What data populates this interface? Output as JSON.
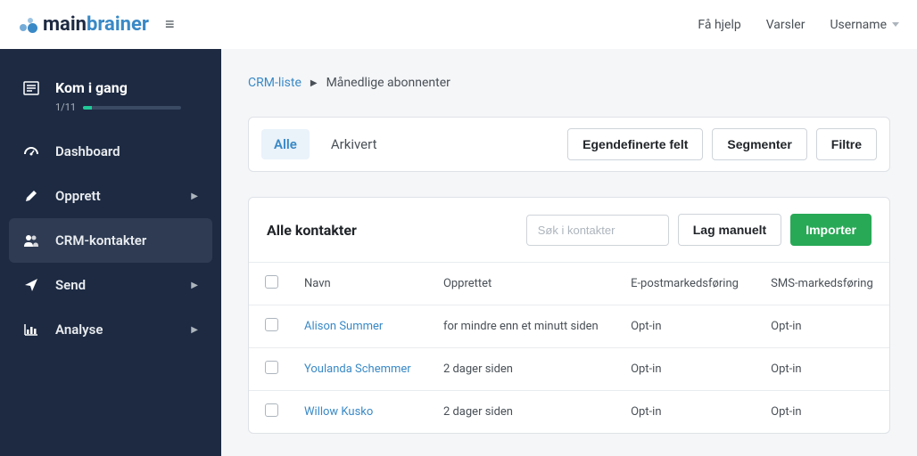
{
  "topbar": {
    "logo_main": "main",
    "logo_accent": "brainer",
    "help": "Få hjelp",
    "alerts": "Varsler",
    "username": "Username"
  },
  "sidebar": {
    "getting_started": {
      "title": "Kom i gang",
      "count": "1/11"
    },
    "items": [
      {
        "label": "Dashboard",
        "has_sub": false
      },
      {
        "label": "Opprett",
        "has_sub": true
      },
      {
        "label": "CRM-kontakter",
        "has_sub": false,
        "active": true
      },
      {
        "label": "Send",
        "has_sub": true
      },
      {
        "label": "Analyse",
        "has_sub": true
      }
    ]
  },
  "breadcrumb": {
    "parent": "CRM-liste",
    "current": "Månedlige abonnenter"
  },
  "tabs": {
    "all": "Alle",
    "archived": "Arkivert",
    "custom_fields": "Egendefinerte felt",
    "segments": "Segmenter",
    "filters": "Filtre"
  },
  "table": {
    "title": "Alle kontakter",
    "search_placeholder": "Søk i kontakter",
    "create_manual": "Lag manuelt",
    "import": "Importer",
    "columns": {
      "name": "Navn",
      "created": "Opprettet",
      "email": "E-postmarkedsføring",
      "sms": "SMS-markedsføring"
    },
    "rows": [
      {
        "name": "Alison Summer",
        "created": "for mindre enn et minutt siden",
        "email": "Opt-in",
        "sms": "Opt-in",
        "highlight": true
      },
      {
        "name": "Youlanda Schemmer",
        "created": "2 dager siden",
        "email": "Opt-in",
        "sms": "Opt-in"
      },
      {
        "name": "Willow Kusko",
        "created": "2 dager siden",
        "email": "Opt-in",
        "sms": "Opt-in"
      }
    ]
  }
}
